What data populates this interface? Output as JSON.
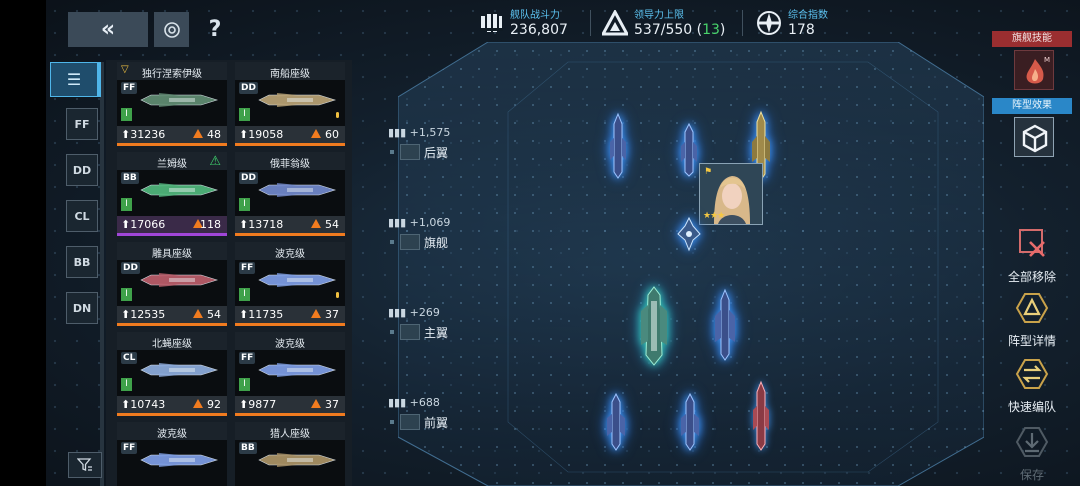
{
  "toolbar": {
    "back_icon": "double-chevron-left-icon",
    "back_label": "«",
    "settings_icon": "target-icon",
    "help_label": "?"
  },
  "top_stats": [
    {
      "label": "舰队战斗力",
      "value": "236,807",
      "icon": "fleet-power-icon"
    },
    {
      "label": "领导力上限",
      "value": "537/550",
      "extra": "13",
      "icon": "leadership-icon"
    },
    {
      "label": "综合指数",
      "value": "178",
      "icon": "index-icon"
    }
  ],
  "categories": [
    "☰",
    "FF",
    "DD",
    "CL",
    "BB",
    "DN"
  ],
  "ships": [
    {
      "name": "独行涅索伊级",
      "class": "FF",
      "tier": "I",
      "power": "31236",
      "level": "48",
      "rarity": "orange",
      "color": "#5f8a70"
    },
    {
      "name": "南船座级",
      "class": "DD",
      "tier": "I",
      "power": "19058",
      "level": "60",
      "rarity": "orange",
      "color": "#b59f72"
    },
    {
      "name": "兰姆级",
      "class": "BB",
      "tier": "I",
      "power": "17066",
      "level": "118",
      "rarity": "purple",
      "color": "#4fb37a"
    },
    {
      "name": "俄菲翁级",
      "class": "DD",
      "tier": "I",
      "power": "13718",
      "level": "54",
      "rarity": "orange",
      "color": "#6f86c8"
    },
    {
      "name": "雕具座级",
      "class": "DD",
      "tier": "I",
      "power": "12535",
      "level": "54",
      "rarity": "orange",
      "color": "#b75b68"
    },
    {
      "name": "波克级",
      "class": "FF",
      "tier": "I",
      "power": "11735",
      "level": "37",
      "rarity": "orange",
      "color": "#7b9ae0"
    },
    {
      "name": "北蝇座级",
      "class": "CL",
      "tier": "I",
      "power": "10743",
      "level": "92",
      "rarity": "orange",
      "color": "#8aa8d8"
    },
    {
      "name": "波克级",
      "class": "FF",
      "tier": "I",
      "power": "9877",
      "level": "37",
      "rarity": "orange",
      "color": "#7b9ae0"
    },
    {
      "name": "波克级",
      "class": "FF",
      "tier": "",
      "power": "",
      "level": "",
      "rarity": "orange",
      "color": "#7b9ae0"
    },
    {
      "name": "猎人座级",
      "class": "BB",
      "tier": "",
      "power": "",
      "level": "",
      "rarity": "orange",
      "color": "#a89064"
    }
  ],
  "formation_rows": [
    {
      "power": "+1,575",
      "name": "后翼"
    },
    {
      "power": "+1,069",
      "name": "旗舰"
    },
    {
      "power": "+269",
      "name": "主翼"
    },
    {
      "power": "+688",
      "name": "前翼"
    }
  ],
  "right_panel": {
    "flagship_skill_label": "旗舰技能",
    "formation_effect_label": "阵型效果",
    "remove_all_label": "全部移除",
    "formation_detail_label": "阵型详情",
    "quick_fleet_label": "快速编队",
    "save_label": "保存"
  },
  "colors": {
    "accent": "#4fb6ea",
    "orange": "#f07b1f",
    "purple": "#a046d8",
    "green": "#48d36b",
    "red_tag": "#9a2e30"
  }
}
